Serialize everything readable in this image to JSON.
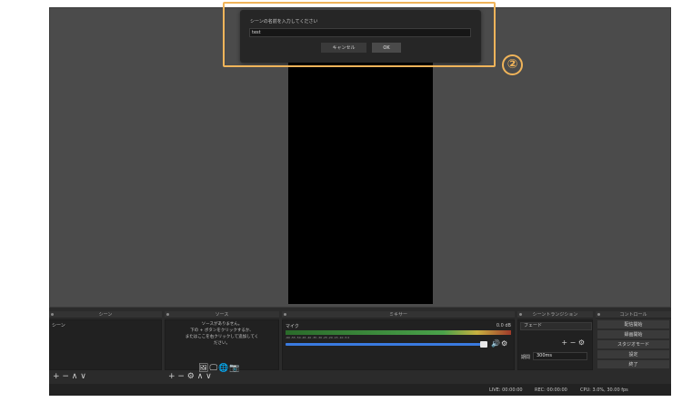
{
  "dialog": {
    "prompt": "シーンの名前を入力してください",
    "input_value": "test",
    "cancel_label": "キャンセル",
    "ok_label": "OK"
  },
  "annotation": {
    "marker": "②",
    "color": "#f0b45a"
  },
  "docks": {
    "scenes": {
      "title": "シーン",
      "items": [
        "シーン"
      ],
      "toolbar": "+ − ∧ ∨"
    },
    "sources": {
      "title": "ソース",
      "hint_lines": [
        "ソースがありません。",
        "下の + ボタンをクリックするか、",
        "またはここを右クリックして追加してく",
        "ださい。"
      ],
      "toolbar": "+ − ⚙ ∧ ∨"
    },
    "mixer": {
      "title": "ミキサー",
      "track_name": "マイク",
      "level": "0.0 dB",
      "scale": "-60 -55 -50 -45 -40 -35 -30 -25 -20 -15 -10 -5 0",
      "volume_fraction": 0.9
    },
    "transitions": {
      "title": "シーントランジション",
      "type": "フェード",
      "duration_label": "期間",
      "duration_value": "300ms",
      "buttons": "+ − ⚙"
    },
    "controls": {
      "title": "コントロール",
      "buttons": [
        "配信開始",
        "録画開始",
        "スタジオモード",
        "設定",
        "終了"
      ]
    }
  },
  "status": {
    "live": "LIVE: 00:00:00",
    "rec": "REC: 00:00:00",
    "cpu": "CPU: 3.0%, 30.00 fps"
  },
  "colors": {
    "accent_blue": "#3a7adf",
    "preview_bg": "#4b4b4b",
    "panel_bg": "#2b2b2b"
  }
}
